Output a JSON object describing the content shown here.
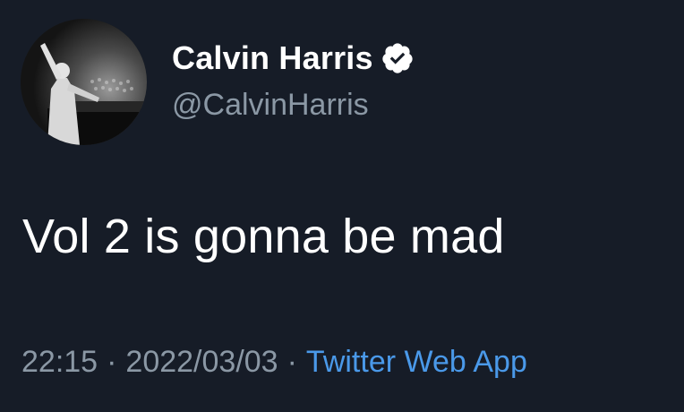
{
  "author": {
    "name": "Calvin Harris",
    "handle": "@CalvinHarris",
    "verified_icon": "verified-badge-icon"
  },
  "tweet": {
    "text": "Vol 2 is gonna be mad"
  },
  "meta": {
    "time": "22:15",
    "separator": "·",
    "date": "2022/03/03",
    "source": "Twitter Web App"
  },
  "colors": {
    "background": "#161c27",
    "text": "#ffffff",
    "muted": "#8b98a5",
    "link": "#4a99e9"
  }
}
